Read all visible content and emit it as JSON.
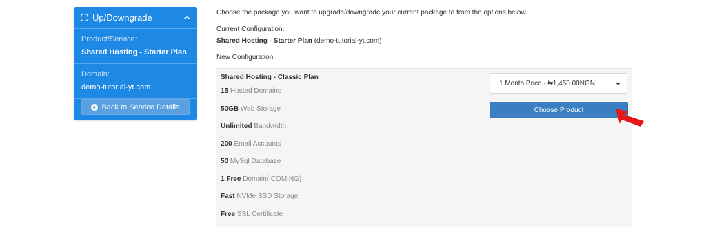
{
  "sidebar": {
    "title": "Up/Downgrade",
    "product_label": "Product/Service:",
    "product_value": "Shared Hosting - Starter Plan",
    "domain_label": "Domain:",
    "domain_value": "demo-tutorial-yt.com",
    "back_button": "Back to Service Details",
    "icons": [
      "expand-icon",
      "chevron-up-icon",
      "arrow-circle-left-icon"
    ]
  },
  "main": {
    "intro": "Choose the package you want to upgrade/downgrade your current package to from the options below.",
    "current_config_label": "Current Configuration:",
    "current_plan": "Shared Hosting - Starter Plan",
    "current_domain": "(demo-tutorial-yt.com)",
    "new_config_label": "New Configuration:",
    "package": {
      "name": "Shared Hosting - Classic Plan",
      "features": [
        {
          "value": "15",
          "label": "Hosted Domains"
        },
        {
          "value": "50GB",
          "label": "Web Storage"
        },
        {
          "value": "Unlimited",
          "label": "Bandwidth"
        },
        {
          "value": "200",
          "label": "Email Accounts"
        },
        {
          "value": "50",
          "label": "MySql Database"
        },
        {
          "value": "1 Free",
          "label": "Domain(.COM.NG)"
        },
        {
          "value": "Fast",
          "label": "NVMe SSD Storage"
        },
        {
          "value": "Free",
          "label": "SSL Certificate"
        }
      ],
      "billing_select": "1 Month Price - ₦1,450.00NGN",
      "choose_button": "Choose Product"
    }
  },
  "colors": {
    "sidebar_bg": "#1e88e5",
    "button_blue": "#3a7fc1",
    "arrow_red": "#e8151b"
  }
}
